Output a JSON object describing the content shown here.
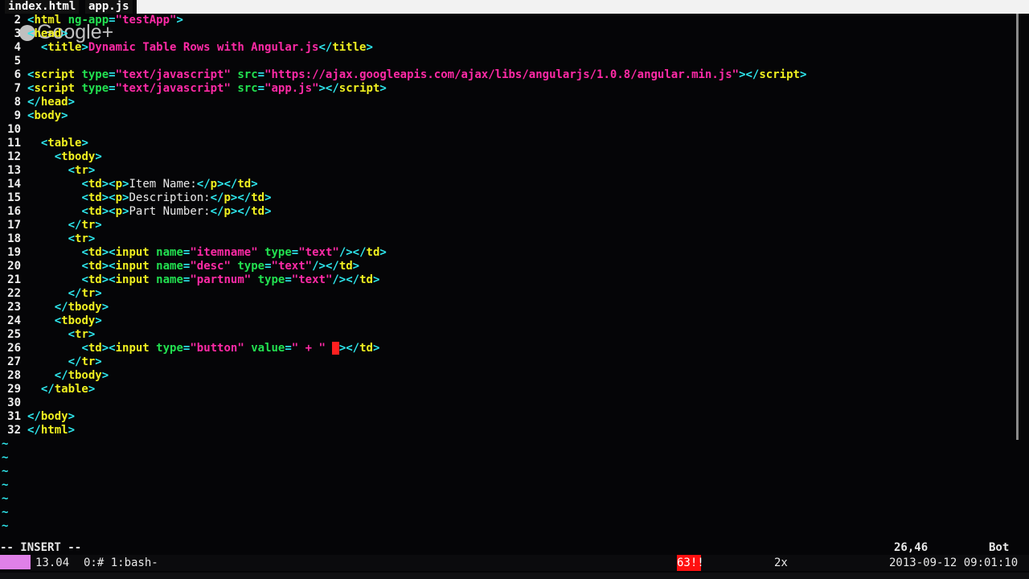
{
  "tabs": [
    "index.html",
    "app.js"
  ],
  "overlay_logo": "Google+",
  "code_lines": [
    {
      "n": "2",
      "segs": [
        [
          "tg",
          "<"
        ],
        [
          "tn",
          "html"
        ],
        [
          "at",
          " ng-app"
        ],
        [
          "tg",
          "="
        ],
        [
          "st",
          "\"testApp\""
        ],
        [
          "tg",
          ">"
        ]
      ]
    },
    {
      "n": "3",
      "segs": [
        [
          "tg",
          "<"
        ],
        [
          "tn",
          "head"
        ],
        [
          "tg",
          ">"
        ]
      ]
    },
    {
      "n": "4",
      "segs": [
        [
          "tx",
          "  "
        ],
        [
          "tg",
          "<"
        ],
        [
          "tn",
          "title"
        ],
        [
          "tg",
          ">"
        ],
        [
          "st",
          "Dynamic Table Rows with Angular.js"
        ],
        [
          "tg",
          "</"
        ],
        [
          "tn",
          "title"
        ],
        [
          "tg",
          ">"
        ]
      ]
    },
    {
      "n": "5",
      "segs": []
    },
    {
      "n": "6",
      "segs": [
        [
          "tg",
          "<"
        ],
        [
          "tn",
          "script"
        ],
        [
          "at",
          " type"
        ],
        [
          "tg",
          "="
        ],
        [
          "st",
          "\"text/javascript\""
        ],
        [
          "at",
          " src"
        ],
        [
          "tg",
          "="
        ],
        [
          "st",
          "\"https://ajax.googleapis.com/ajax/libs/angularjs/1.0.8/angular.min.js\""
        ],
        [
          "tg",
          "></"
        ],
        [
          "tn",
          "script"
        ],
        [
          "tg",
          ">"
        ]
      ]
    },
    {
      "n": "7",
      "segs": [
        [
          "tg",
          "<"
        ],
        [
          "tn",
          "script"
        ],
        [
          "at",
          " type"
        ],
        [
          "tg",
          "="
        ],
        [
          "st",
          "\"text/javascript\""
        ],
        [
          "at",
          " src"
        ],
        [
          "tg",
          "="
        ],
        [
          "st",
          "\"app.js\""
        ],
        [
          "tg",
          "></"
        ],
        [
          "tn",
          "script"
        ],
        [
          "tg",
          ">"
        ]
      ]
    },
    {
      "n": "8",
      "segs": [
        [
          "tg",
          "</"
        ],
        [
          "tn",
          "head"
        ],
        [
          "tg",
          ">"
        ]
      ]
    },
    {
      "n": "9",
      "segs": [
        [
          "tg",
          "<"
        ],
        [
          "tn",
          "body"
        ],
        [
          "tg",
          ">"
        ]
      ]
    },
    {
      "n": "10",
      "segs": []
    },
    {
      "n": "11",
      "segs": [
        [
          "tx",
          "  "
        ],
        [
          "tg",
          "<"
        ],
        [
          "tn",
          "table"
        ],
        [
          "tg",
          ">"
        ]
      ]
    },
    {
      "n": "12",
      "segs": [
        [
          "tx",
          "    "
        ],
        [
          "tg",
          "<"
        ],
        [
          "tn",
          "tbody"
        ],
        [
          "tg",
          ">"
        ]
      ]
    },
    {
      "n": "13",
      "segs": [
        [
          "tx",
          "      "
        ],
        [
          "tg",
          "<"
        ],
        [
          "tn",
          "tr"
        ],
        [
          "tg",
          ">"
        ]
      ]
    },
    {
      "n": "14",
      "segs": [
        [
          "tx",
          "        "
        ],
        [
          "tg",
          "<"
        ],
        [
          "tn",
          "td"
        ],
        [
          "tg",
          "><"
        ],
        [
          "tn",
          "p"
        ],
        [
          "tg",
          ">"
        ],
        [
          "tx",
          "Item Name:"
        ],
        [
          "tg",
          "</"
        ],
        [
          "tn",
          "p"
        ],
        [
          "tg",
          "></"
        ],
        [
          "tn",
          "td"
        ],
        [
          "tg",
          ">"
        ]
      ]
    },
    {
      "n": "15",
      "segs": [
        [
          "tx",
          "        "
        ],
        [
          "tg",
          "<"
        ],
        [
          "tn",
          "td"
        ],
        [
          "tg",
          "><"
        ],
        [
          "tn",
          "p"
        ],
        [
          "tg",
          ">"
        ],
        [
          "tx",
          "Description:"
        ],
        [
          "tg",
          "</"
        ],
        [
          "tn",
          "p"
        ],
        [
          "tg",
          "></"
        ],
        [
          "tn",
          "td"
        ],
        [
          "tg",
          ">"
        ]
      ]
    },
    {
      "n": "16",
      "segs": [
        [
          "tx",
          "        "
        ],
        [
          "tg",
          "<"
        ],
        [
          "tn",
          "td"
        ],
        [
          "tg",
          "><"
        ],
        [
          "tn",
          "p"
        ],
        [
          "tg",
          ">"
        ],
        [
          "tx",
          "Part Number:"
        ],
        [
          "tg",
          "</"
        ],
        [
          "tn",
          "p"
        ],
        [
          "tg",
          "></"
        ],
        [
          "tn",
          "td"
        ],
        [
          "tg",
          ">"
        ]
      ]
    },
    {
      "n": "17",
      "segs": [
        [
          "tx",
          "      "
        ],
        [
          "tg",
          "</"
        ],
        [
          "tn",
          "tr"
        ],
        [
          "tg",
          ">"
        ]
      ]
    },
    {
      "n": "18",
      "segs": [
        [
          "tx",
          "      "
        ],
        [
          "tg",
          "<"
        ],
        [
          "tn",
          "tr"
        ],
        [
          "tg",
          ">"
        ]
      ]
    },
    {
      "n": "19",
      "segs": [
        [
          "tx",
          "        "
        ],
        [
          "tg",
          "<"
        ],
        [
          "tn",
          "td"
        ],
        [
          "tg",
          "><"
        ],
        [
          "tn",
          "input"
        ],
        [
          "at",
          " name"
        ],
        [
          "tg",
          "="
        ],
        [
          "st",
          "\"itemname\""
        ],
        [
          "at",
          " type"
        ],
        [
          "tg",
          "="
        ],
        [
          "st",
          "\"text\""
        ],
        [
          "tg",
          "/></"
        ],
        [
          "tn",
          "td"
        ],
        [
          "tg",
          ">"
        ]
      ]
    },
    {
      "n": "20",
      "segs": [
        [
          "tx",
          "        "
        ],
        [
          "tg",
          "<"
        ],
        [
          "tn",
          "td"
        ],
        [
          "tg",
          "><"
        ],
        [
          "tn",
          "input"
        ],
        [
          "at",
          " name"
        ],
        [
          "tg",
          "="
        ],
        [
          "st",
          "\"desc\""
        ],
        [
          "at",
          " type"
        ],
        [
          "tg",
          "="
        ],
        [
          "st",
          "\"text\""
        ],
        [
          "tg",
          "/></"
        ],
        [
          "tn",
          "td"
        ],
        [
          "tg",
          ">"
        ]
      ]
    },
    {
      "n": "21",
      "segs": [
        [
          "tx",
          "        "
        ],
        [
          "tg",
          "<"
        ],
        [
          "tn",
          "td"
        ],
        [
          "tg",
          "><"
        ],
        [
          "tn",
          "input"
        ],
        [
          "at",
          " name"
        ],
        [
          "tg",
          "="
        ],
        [
          "st",
          "\"partnum\""
        ],
        [
          "at",
          " type"
        ],
        [
          "tg",
          "="
        ],
        [
          "st",
          "\"text\""
        ],
        [
          "tg",
          "/></"
        ],
        [
          "tn",
          "td"
        ],
        [
          "tg",
          ">"
        ]
      ]
    },
    {
      "n": "22",
      "segs": [
        [
          "tx",
          "      "
        ],
        [
          "tg",
          "</"
        ],
        [
          "tn",
          "tr"
        ],
        [
          "tg",
          ">"
        ]
      ]
    },
    {
      "n": "23",
      "segs": [
        [
          "tx",
          "    "
        ],
        [
          "tg",
          "</"
        ],
        [
          "tn",
          "tbody"
        ],
        [
          "tg",
          ">"
        ]
      ]
    },
    {
      "n": "24",
      "segs": [
        [
          "tx",
          "    "
        ],
        [
          "tg",
          "<"
        ],
        [
          "tn",
          "tbody"
        ],
        [
          "tg",
          ">"
        ]
      ]
    },
    {
      "n": "25",
      "segs": [
        [
          "tx",
          "      "
        ],
        [
          "tg",
          "<"
        ],
        [
          "tn",
          "tr"
        ],
        [
          "tg",
          ">"
        ]
      ]
    },
    {
      "n": "26",
      "segs": [
        [
          "tx",
          "        "
        ],
        [
          "tg",
          "<"
        ],
        [
          "tn",
          "td"
        ],
        [
          "tg",
          "><"
        ],
        [
          "tn",
          "input"
        ],
        [
          "at",
          " type"
        ],
        [
          "tg",
          "="
        ],
        [
          "st",
          "\"button\""
        ],
        [
          "at",
          " value"
        ],
        [
          "tg",
          "="
        ],
        [
          "st",
          "\" + \""
        ],
        [
          "tx",
          " "
        ],
        [
          "cursor",
          "/"
        ],
        [
          "tg",
          "></"
        ],
        [
          "tn",
          "td"
        ],
        [
          "tg",
          ">"
        ]
      ]
    },
    {
      "n": "27",
      "segs": [
        [
          "tx",
          "      "
        ],
        [
          "tg",
          "</"
        ],
        [
          "tn",
          "tr"
        ],
        [
          "tg",
          ">"
        ]
      ]
    },
    {
      "n": "28",
      "segs": [
        [
          "tx",
          "    "
        ],
        [
          "tg",
          "</"
        ],
        [
          "tn",
          "tbody"
        ],
        [
          "tg",
          ">"
        ]
      ]
    },
    {
      "n": "29",
      "segs": [
        [
          "tx",
          "  "
        ],
        [
          "tg",
          "</"
        ],
        [
          "tn",
          "table"
        ],
        [
          "tg",
          ">"
        ]
      ]
    },
    {
      "n": "30",
      "segs": []
    },
    {
      "n": "31",
      "segs": [
        [
          "tg",
          "</"
        ],
        [
          "tn",
          "body"
        ],
        [
          "tg",
          ">"
        ]
      ]
    },
    {
      "n": "32",
      "segs": [
        [
          "tg",
          "</"
        ],
        [
          "tn",
          "html"
        ],
        [
          "tg",
          ">"
        ]
      ]
    }
  ],
  "tilde_char": "~",
  "mode": "-- INSERT --",
  "cursor_pos": "26,46",
  "scroll_pos": "Bot",
  "status": {
    "load": "13.04",
    "window": "0:# 1:bash-",
    "red_badge": "63!!",
    "counter": "2x",
    "datetime": "2013-09-12 09:01:10"
  },
  "colors": {
    "tag": "#2ee8ee",
    "tagname": "#f0f020",
    "attr": "#22e050",
    "string": "#ff2aa6"
  }
}
